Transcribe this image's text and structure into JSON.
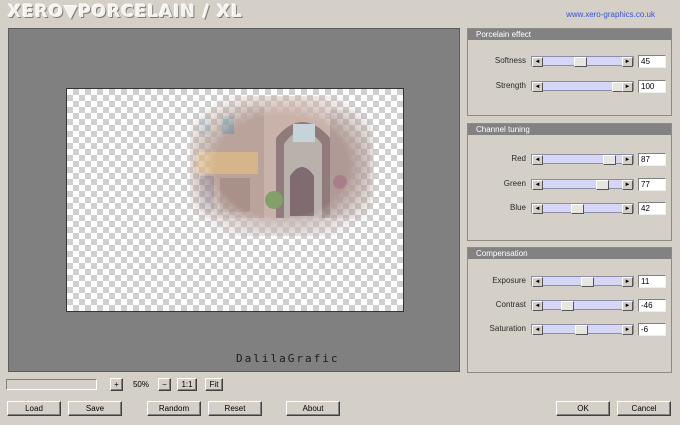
{
  "header": {
    "logo": "XERO▼PORCELAIN / XL",
    "url": "www.xero-graphics.co.uk"
  },
  "preview": {
    "watermark": "DalilaGrafic"
  },
  "panels": {
    "porcelain": {
      "title": "Porcelain effect",
      "sliders": [
        {
          "label": "Softness",
          "value": "45",
          "pos": 0.45
        },
        {
          "label": "Strength",
          "value": "100",
          "pos": 1.0
        }
      ]
    },
    "channel": {
      "title": "Channel tuning",
      "sliders": [
        {
          "label": "Red",
          "value": "87",
          "pos": 0.87
        },
        {
          "label": "Green",
          "value": "77",
          "pos": 0.77
        },
        {
          "label": "Blue",
          "value": "42",
          "pos": 0.42
        }
      ]
    },
    "compensation": {
      "title": "Compensation",
      "sliders": [
        {
          "label": "Exposure",
          "value": "11",
          "pos": 0.555
        },
        {
          "label": "Contrast",
          "value": "-46",
          "pos": 0.27
        },
        {
          "label": "Saturation",
          "value": "-6",
          "pos": 0.47
        }
      ]
    }
  },
  "zoom": {
    "plus": "+",
    "value": "50%",
    "minus": "−",
    "one_to_one": "1:1",
    "fit": "Fit"
  },
  "buttons": {
    "load": "Load",
    "save": "Save",
    "random": "Random",
    "reset": "Reset",
    "about": "About",
    "ok": "OK",
    "cancel": "Cancel"
  },
  "icons": {
    "arrow_left": "◄",
    "arrow_right": "►"
  },
  "colors": {
    "panel_header": "#828282",
    "track": "#d6d6f8",
    "url": "#3a52d0",
    "preview_bg": "#808080"
  }
}
